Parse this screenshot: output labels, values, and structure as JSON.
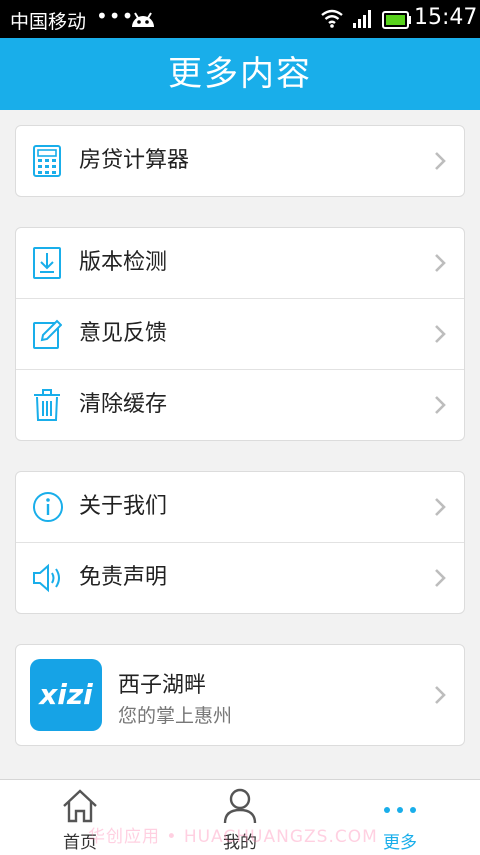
{
  "status_bar": {
    "carrier": "中国移动",
    "dots": "•••",
    "time": "15:47"
  },
  "header": {
    "title": "更多内容"
  },
  "groups": {
    "tools": {
      "mortgage": "房贷计算器"
    },
    "app": {
      "update": "版本检测",
      "feedback": "意见反馈",
      "clear_cache": "清除缓存"
    },
    "info": {
      "about": "关于我们",
      "disclaimer": "免责声明"
    },
    "promo": {
      "logo_text": "xizi",
      "name": "西子湖畔",
      "slogan": "您的掌上惠州"
    }
  },
  "tabbar": {
    "home": "首页",
    "mine": "我的",
    "more": "更多"
  },
  "watermark": "华创应用 • HUACHUANGZS.COM",
  "colors": {
    "accent": "#19aeea",
    "logo_bg": "#16a3e6"
  }
}
